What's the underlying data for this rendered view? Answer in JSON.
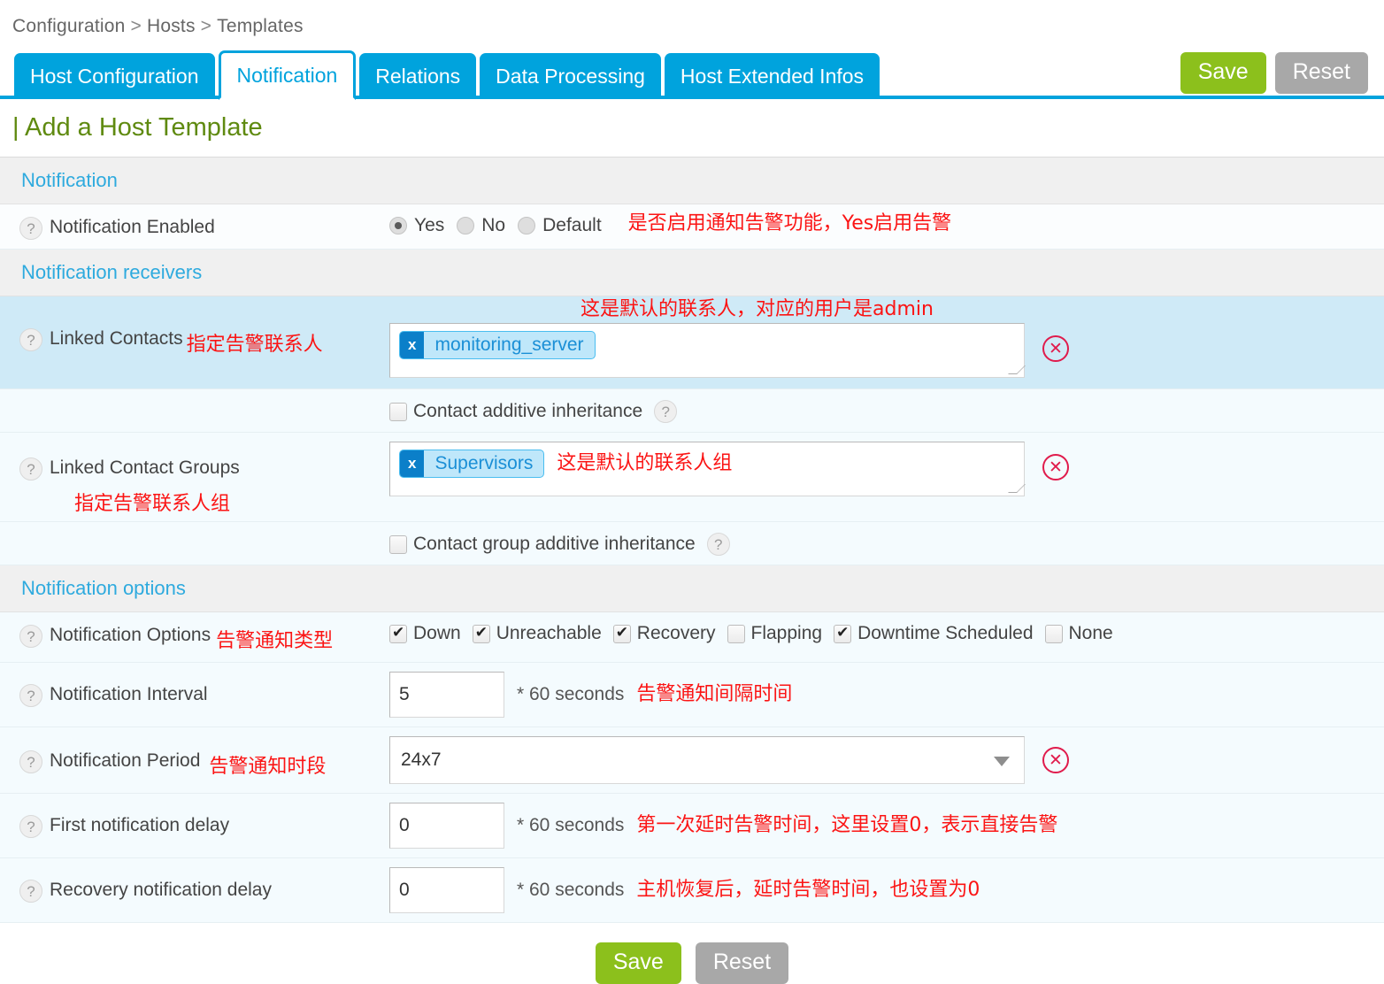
{
  "breadcrumb": {
    "items": [
      "Configuration",
      "Hosts",
      "Templates"
    ],
    "separator": ">"
  },
  "tabs": [
    {
      "label": "Host Configuration",
      "active": false
    },
    {
      "label": "Notification",
      "active": true
    },
    {
      "label": "Relations",
      "active": false
    },
    {
      "label": "Data Processing",
      "active": false
    },
    {
      "label": "Host Extended Infos",
      "active": false
    }
  ],
  "toolbar": {
    "save_label": "Save",
    "reset_label": "Reset"
  },
  "page_title": "| Add a Host Template",
  "sections": {
    "notification": "Notification",
    "receivers": "Notification receivers",
    "options": "Notification options"
  },
  "help_glyph": "?",
  "delete_glyph": "✕",
  "notification_enabled": {
    "label": "Notification Enabled",
    "options": [
      {
        "label": "Yes",
        "selected": true
      },
      {
        "label": "No",
        "selected": false
      },
      {
        "label": "Default",
        "selected": false
      }
    ],
    "annotation": "是否启用通知告警功能，Yes启用告警"
  },
  "linked_contacts": {
    "label": "Linked Contacts",
    "label_annotation": "指定告警联系人",
    "top_annotation": "这是默认的联系人，对应的用户是admin",
    "chips": [
      {
        "remove": "x",
        "name": "monitoring_server"
      }
    ],
    "additive": {
      "label": "Contact additive inheritance",
      "checked": false
    }
  },
  "linked_contact_groups": {
    "label": "Linked Contact Groups",
    "label_annotation": "指定告警联系人组",
    "field_annotation": "这是默认的联系人组",
    "chips": [
      {
        "remove": "x",
        "name": "Supervisors"
      }
    ],
    "additive": {
      "label": "Contact group additive inheritance",
      "checked": false
    }
  },
  "notification_options": {
    "label": "Notification Options",
    "label_annotation": "告警通知类型",
    "items": [
      {
        "label": "Down",
        "checked": true
      },
      {
        "label": "Unreachable",
        "checked": true
      },
      {
        "label": "Recovery",
        "checked": true
      },
      {
        "label": "Flapping",
        "checked": false
      },
      {
        "label": "Downtime Scheduled",
        "checked": true
      },
      {
        "label": "None",
        "checked": false
      }
    ]
  },
  "notification_interval": {
    "label": "Notification Interval",
    "value": "5",
    "unit": "* 60 seconds",
    "annotation": "告警通知间隔时间"
  },
  "notification_period": {
    "label": "Notification Period",
    "label_annotation": "告警通知时段",
    "value": "24x7"
  },
  "first_notification_delay": {
    "label": "First notification delay",
    "value": "0",
    "unit": "* 60 seconds",
    "annotation": "第一次延时告警时间，这里设置0，表示直接告警"
  },
  "recovery_notification_delay": {
    "label": "Recovery notification delay",
    "value": "0",
    "unit": "* 60 seconds",
    "annotation": "主机恢复后，延时告警时间，也设置为0"
  },
  "colors": {
    "tab_blue": "#00a3dd",
    "save_green": "#8cc01c",
    "reset_gray": "#a8a8a8",
    "title_olive": "#5f8a10",
    "annotation_red": "#fb1414",
    "chip_blue": "#bfe7fa",
    "delete_red": "#e01b4c"
  }
}
